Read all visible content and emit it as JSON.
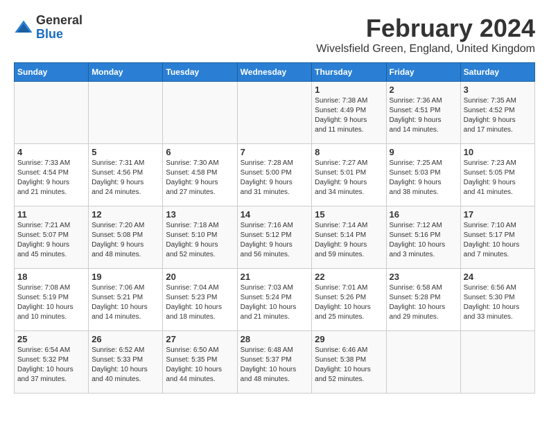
{
  "logo": {
    "general": "General",
    "blue": "Blue"
  },
  "title": {
    "month_year": "February 2024",
    "location": "Wivelsfield Green, England, United Kingdom"
  },
  "headers": [
    "Sunday",
    "Monday",
    "Tuesday",
    "Wednesday",
    "Thursday",
    "Friday",
    "Saturday"
  ],
  "weeks": [
    [
      {
        "day": "",
        "info": ""
      },
      {
        "day": "",
        "info": ""
      },
      {
        "day": "",
        "info": ""
      },
      {
        "day": "",
        "info": ""
      },
      {
        "day": "1",
        "info": "Sunrise: 7:38 AM\nSunset: 4:49 PM\nDaylight: 9 hours\nand 11 minutes."
      },
      {
        "day": "2",
        "info": "Sunrise: 7:36 AM\nSunset: 4:51 PM\nDaylight: 9 hours\nand 14 minutes."
      },
      {
        "day": "3",
        "info": "Sunrise: 7:35 AM\nSunset: 4:52 PM\nDaylight: 9 hours\nand 17 minutes."
      }
    ],
    [
      {
        "day": "4",
        "info": "Sunrise: 7:33 AM\nSunset: 4:54 PM\nDaylight: 9 hours\nand 21 minutes."
      },
      {
        "day": "5",
        "info": "Sunrise: 7:31 AM\nSunset: 4:56 PM\nDaylight: 9 hours\nand 24 minutes."
      },
      {
        "day": "6",
        "info": "Sunrise: 7:30 AM\nSunset: 4:58 PM\nDaylight: 9 hours\nand 27 minutes."
      },
      {
        "day": "7",
        "info": "Sunrise: 7:28 AM\nSunset: 5:00 PM\nDaylight: 9 hours\nand 31 minutes."
      },
      {
        "day": "8",
        "info": "Sunrise: 7:27 AM\nSunset: 5:01 PM\nDaylight: 9 hours\nand 34 minutes."
      },
      {
        "day": "9",
        "info": "Sunrise: 7:25 AM\nSunset: 5:03 PM\nDaylight: 9 hours\nand 38 minutes."
      },
      {
        "day": "10",
        "info": "Sunrise: 7:23 AM\nSunset: 5:05 PM\nDaylight: 9 hours\nand 41 minutes."
      }
    ],
    [
      {
        "day": "11",
        "info": "Sunrise: 7:21 AM\nSunset: 5:07 PM\nDaylight: 9 hours\nand 45 minutes."
      },
      {
        "day": "12",
        "info": "Sunrise: 7:20 AM\nSunset: 5:08 PM\nDaylight: 9 hours\nand 48 minutes."
      },
      {
        "day": "13",
        "info": "Sunrise: 7:18 AM\nSunset: 5:10 PM\nDaylight: 9 hours\nand 52 minutes."
      },
      {
        "day": "14",
        "info": "Sunrise: 7:16 AM\nSunset: 5:12 PM\nDaylight: 9 hours\nand 56 minutes."
      },
      {
        "day": "15",
        "info": "Sunrise: 7:14 AM\nSunset: 5:14 PM\nDaylight: 9 hours\nand 59 minutes."
      },
      {
        "day": "16",
        "info": "Sunrise: 7:12 AM\nSunset: 5:16 PM\nDaylight: 10 hours\nand 3 minutes."
      },
      {
        "day": "17",
        "info": "Sunrise: 7:10 AM\nSunset: 5:17 PM\nDaylight: 10 hours\nand 7 minutes."
      }
    ],
    [
      {
        "day": "18",
        "info": "Sunrise: 7:08 AM\nSunset: 5:19 PM\nDaylight: 10 hours\nand 10 minutes."
      },
      {
        "day": "19",
        "info": "Sunrise: 7:06 AM\nSunset: 5:21 PM\nDaylight: 10 hours\nand 14 minutes."
      },
      {
        "day": "20",
        "info": "Sunrise: 7:04 AM\nSunset: 5:23 PM\nDaylight: 10 hours\nand 18 minutes."
      },
      {
        "day": "21",
        "info": "Sunrise: 7:03 AM\nSunset: 5:24 PM\nDaylight: 10 hours\nand 21 minutes."
      },
      {
        "day": "22",
        "info": "Sunrise: 7:01 AM\nSunset: 5:26 PM\nDaylight: 10 hours\nand 25 minutes."
      },
      {
        "day": "23",
        "info": "Sunrise: 6:58 AM\nSunset: 5:28 PM\nDaylight: 10 hours\nand 29 minutes."
      },
      {
        "day": "24",
        "info": "Sunrise: 6:56 AM\nSunset: 5:30 PM\nDaylight: 10 hours\nand 33 minutes."
      }
    ],
    [
      {
        "day": "25",
        "info": "Sunrise: 6:54 AM\nSunset: 5:32 PM\nDaylight: 10 hours\nand 37 minutes."
      },
      {
        "day": "26",
        "info": "Sunrise: 6:52 AM\nSunset: 5:33 PM\nDaylight: 10 hours\nand 40 minutes."
      },
      {
        "day": "27",
        "info": "Sunrise: 6:50 AM\nSunset: 5:35 PM\nDaylight: 10 hours\nand 44 minutes."
      },
      {
        "day": "28",
        "info": "Sunrise: 6:48 AM\nSunset: 5:37 PM\nDaylight: 10 hours\nand 48 minutes."
      },
      {
        "day": "29",
        "info": "Sunrise: 6:46 AM\nSunset: 5:38 PM\nDaylight: 10 hours\nand 52 minutes."
      },
      {
        "day": "",
        "info": ""
      },
      {
        "day": "",
        "info": ""
      }
    ]
  ]
}
